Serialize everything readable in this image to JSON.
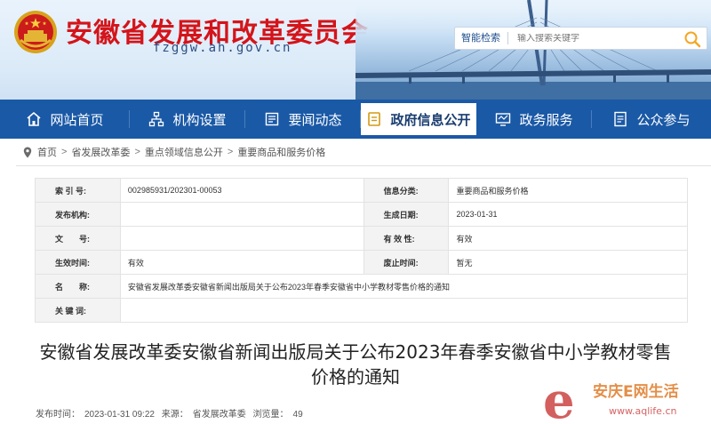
{
  "header": {
    "site_title": "安徽省发展和改革委员会",
    "site_domain": "fzggw.ah.gov.cn",
    "search": {
      "tag": "智能检索",
      "placeholder": "输入搜索关键字"
    }
  },
  "nav": [
    {
      "label": "网站首页",
      "icon": "home-icon"
    },
    {
      "label": "机构设置",
      "icon": "org-chart-icon"
    },
    {
      "label": "要闻动态",
      "icon": "news-icon"
    },
    {
      "label": "政府信息公开",
      "icon": "document-icon",
      "active": true
    },
    {
      "label": "政务服务",
      "icon": "monitor-icon"
    },
    {
      "label": "公众参与",
      "icon": "form-icon"
    }
  ],
  "breadcrumb": [
    "首页",
    "省发展改革委",
    "重点领域信息公开",
    "重要商品和服务价格"
  ],
  "info": {
    "rows": [
      {
        "k1": "索 引 号:",
        "v1": "002985931/202301-00053",
        "k2": "信息分类:",
        "v2": "重要商品和服务价格"
      },
      {
        "k1": "发布机构:",
        "v1": "",
        "k2": "生成日期:",
        "v2": "2023-01-31"
      },
      {
        "k1": "文　　号:",
        "v1": "",
        "k2": "有 效 性:",
        "v2": "有效"
      },
      {
        "k1": "生效时间:",
        "v1": "有效",
        "k2": "废止时间:",
        "v2": "暂无"
      }
    ],
    "name_key": "名　　称:",
    "name_value": "安徽省发展改革委安徽省新闻出版局关于公布2023年春季安徽省中小学教材零售价格的通知",
    "keywords_key": "关 键 词:",
    "keywords_value": ""
  },
  "article": {
    "title": "安徽省发展改革委安徽省新闻出版局关于公布2023年春季安徽省中小学教材零售价格的通知",
    "meta": {
      "publish_label": "发布时间：",
      "publish_time": "2023-01-31 09:22",
      "source_label": "来源：",
      "source": "省发展改革委",
      "views_label": "浏览量：",
      "views": "49"
    }
  },
  "watermark": {
    "text": "安庆E网生活",
    "url": "www.aqlife.cn"
  },
  "colors": {
    "nav_bg": "#1a59a6",
    "title_red": "#d4141a",
    "search_accent": "#f5a623"
  }
}
